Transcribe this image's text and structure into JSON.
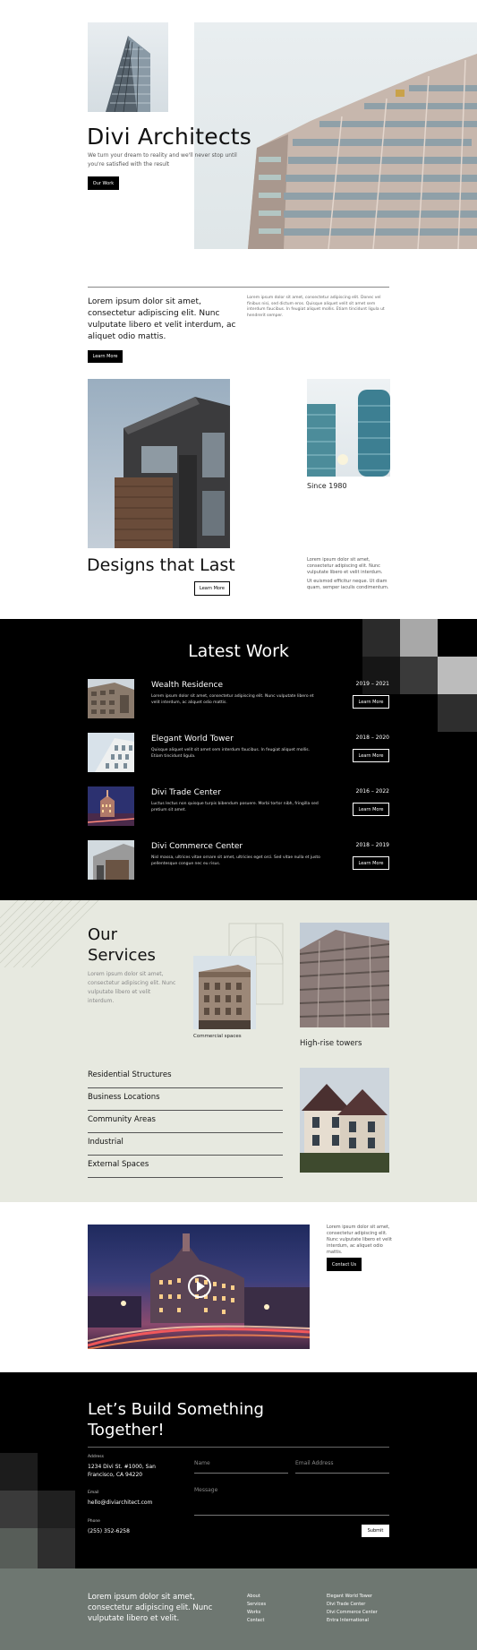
{
  "hero": {
    "title": "Divi Architects",
    "subtitle": "We turn your dream to reality and we'll never stop until you're satisfied with the result",
    "cta": "Our Work"
  },
  "intro": {
    "lead": "Lorem ipsum dolor sit amet, consectetur adipiscing elit. Nunc vulputate libero et velit interdum, ac aliquet odio mattis.",
    "body": "Lorem ipsum dolor sit amet, consectetur adipiscing elit. Donec vel finibus nisi, sed dictum eros. Quisque aliquet velit sit amet sem interdum faucibus. In feugiat aliquet mollis. Etiam tincidunt ligula ut hendrerit semper.",
    "cta": "Learn More"
  },
  "designs": {
    "title": "Designs that Last",
    "cta": "Learn More",
    "since": "Since 1980",
    "text1": "Lorem ipsum dolor sit amet, consectetur adipiscing elit. Nunc vulputate libero et velit interdum.",
    "text2": "Ut euismod efficitur neque. Ut diam quam, semper iaculis condimentum."
  },
  "latest": {
    "title": "Latest Work",
    "items": [
      {
        "name": "Wealth Residence",
        "years": "2019 – 2021",
        "desc": "Lorem ipsum dolor sit amet, consectetur adipiscing elit. Nunc vulputate libero et velit interdum, ac aliquet odio mattis.",
        "cta": "Learn More"
      },
      {
        "name": "Elegant World Tower",
        "years": "2018 – 2020",
        "desc": "Quisque aliquet velit sit amet sem interdum faucibus. In feugiat aliquet mollis. Etiam tincidunt ligula.",
        "cta": "Learn More"
      },
      {
        "name": "Divi Trade Center",
        "years": "2016 – 2022",
        "desc": "Luctus lectus non quisque turpis bibendum posuere. Morbi tortor nibh, fringilla sed pretium sit amet.",
        "cta": "Learn More"
      },
      {
        "name": "Divi Commerce Center",
        "years": "2018 – 2019",
        "desc": "Nisl massa, ultrices vitae ornare sit amet, ultricies eget orci. Sed vitae nulla et justo pellentesque congue nec eu risus.",
        "cta": "Learn More"
      }
    ]
  },
  "services": {
    "title_line1": "Our",
    "title_line2": "Services",
    "desc": "Lorem ipsum dolor sit amet, consectetur adipiscing elit. Nunc vulputate libero et velit interdum.",
    "caption_commercial": "Commercial spaces",
    "caption_highrise": "High-rise towers",
    "items": [
      "Residential Structures",
      "Business Locations",
      "Community Areas",
      "Industrial",
      "External Spaces"
    ]
  },
  "video": {
    "text": "Lorem ipsum dolor sit amet, consectetur adipiscing elit. Nunc vulputate libero et velit interdum, ac aliquet odio mattis.",
    "cta": "Contact Us"
  },
  "contact": {
    "title_line1": "Let’s Build Something",
    "title_line2": "Together!",
    "address_label": "Address",
    "address_line1": "1234 Divi St. #1000, San",
    "address_line2": "Francisco, CA 94220",
    "email_label": "Email",
    "email": "hello@diviarchitect.com",
    "phone_label": "Phone",
    "phone": "(255) 352-6258",
    "name_placeholder": "Name",
    "email_placeholder": "Email Address",
    "message_placeholder": "Message",
    "submit": "Submit"
  },
  "footer": {
    "lead": "Lorem ipsum dolor sit amet, consectetur adipiscing elit. Nunc vulputate libero et velit.",
    "links1": [
      "About",
      "Services",
      "Works",
      "Contact"
    ],
    "links2": [
      "Elegant World Tower",
      "Divi Trade Center",
      "Divi Commerce Center",
      "Entra International"
    ]
  },
  "colors": {
    "dark": "#000000",
    "services_bg": "#e7e9e0",
    "footer_bg": "#6e7771"
  }
}
